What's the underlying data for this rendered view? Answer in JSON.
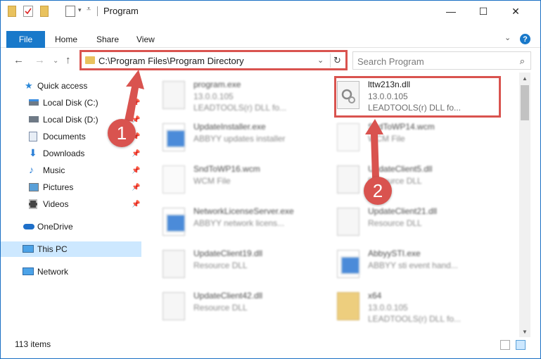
{
  "window": {
    "title": "Program",
    "minimize": "—",
    "maximize": "☐",
    "close": "✕"
  },
  "ribbon": {
    "tabs": [
      "File",
      "Home",
      "Share",
      "View"
    ],
    "help": "?"
  },
  "nav": {
    "address": "C:\\Program Files\\Program Directory",
    "search_placeholder": "Search Program"
  },
  "sidebar": {
    "items": [
      {
        "label": "Quick access",
        "icon": "star-icon"
      },
      {
        "label": "Local Disk (C:)",
        "icon": "drive-icon"
      },
      {
        "label": "Local Disk (D:)",
        "icon": "drive-icon"
      },
      {
        "label": "Documents",
        "icon": "documents-icon"
      },
      {
        "label": "Downloads",
        "icon": "download-icon"
      },
      {
        "label": "Music",
        "icon": "music-icon"
      },
      {
        "label": "Pictures",
        "icon": "pictures-icon"
      },
      {
        "label": "Videos",
        "icon": "videos-icon"
      },
      {
        "label": "OneDrive",
        "icon": "cloud-icon"
      },
      {
        "label": "This PC",
        "icon": "computer-icon"
      },
      {
        "label": "Network",
        "icon": "network-icon"
      }
    ]
  },
  "files": [
    {
      "name": "program.exe",
      "line1": "13.0.0.105",
      "line2": "LEADTOOLS(r) DLL fo...",
      "kind": "exe-gear"
    },
    {
      "name": "lttw213n.dll",
      "line1": "13.0.0.105",
      "line2": "LEADTOOLS(r) DLL fo...",
      "kind": "dll"
    },
    {
      "name": "UpdateInstaller.exe",
      "line1": "ABBYY updates installer",
      "line2": "",
      "kind": "exe"
    },
    {
      "name": "SndToWP14.wcm",
      "line1": "WCM File",
      "line2": "",
      "kind": "doc"
    },
    {
      "name": "SndToWP16.wcm",
      "line1": "WCM File",
      "line2": "",
      "kind": "doc"
    },
    {
      "name": "UpdateClient5.dll",
      "line1": "Resource DLL",
      "line2": "",
      "kind": "dll"
    },
    {
      "name": "NetworkLicenseServer.exe",
      "line1": "ABBYY network licens...",
      "line2": "",
      "kind": "exe"
    },
    {
      "name": "UpdateClient21.dll",
      "line1": "Resource DLL",
      "line2": "",
      "kind": "dll"
    },
    {
      "name": "UpdateClient19.dll",
      "line1": "Resource DLL",
      "line2": "",
      "kind": "dll"
    },
    {
      "name": "AbbyySTI.exe",
      "line1": "ABBYY sti event hand...",
      "line2": "",
      "kind": "exe"
    },
    {
      "name": "UpdateClient42.dll",
      "line1": "Resource DLL",
      "line2": "",
      "kind": "dll"
    },
    {
      "name": "x64",
      "line1": "13.0.0.105",
      "line2": "LEADTOOLS(r) DLL fo...",
      "kind": "folder"
    }
  ],
  "status": {
    "item_count": "113 items"
  },
  "annotations": {
    "step1": "1",
    "step2": "2",
    "color": "#d9534f"
  }
}
